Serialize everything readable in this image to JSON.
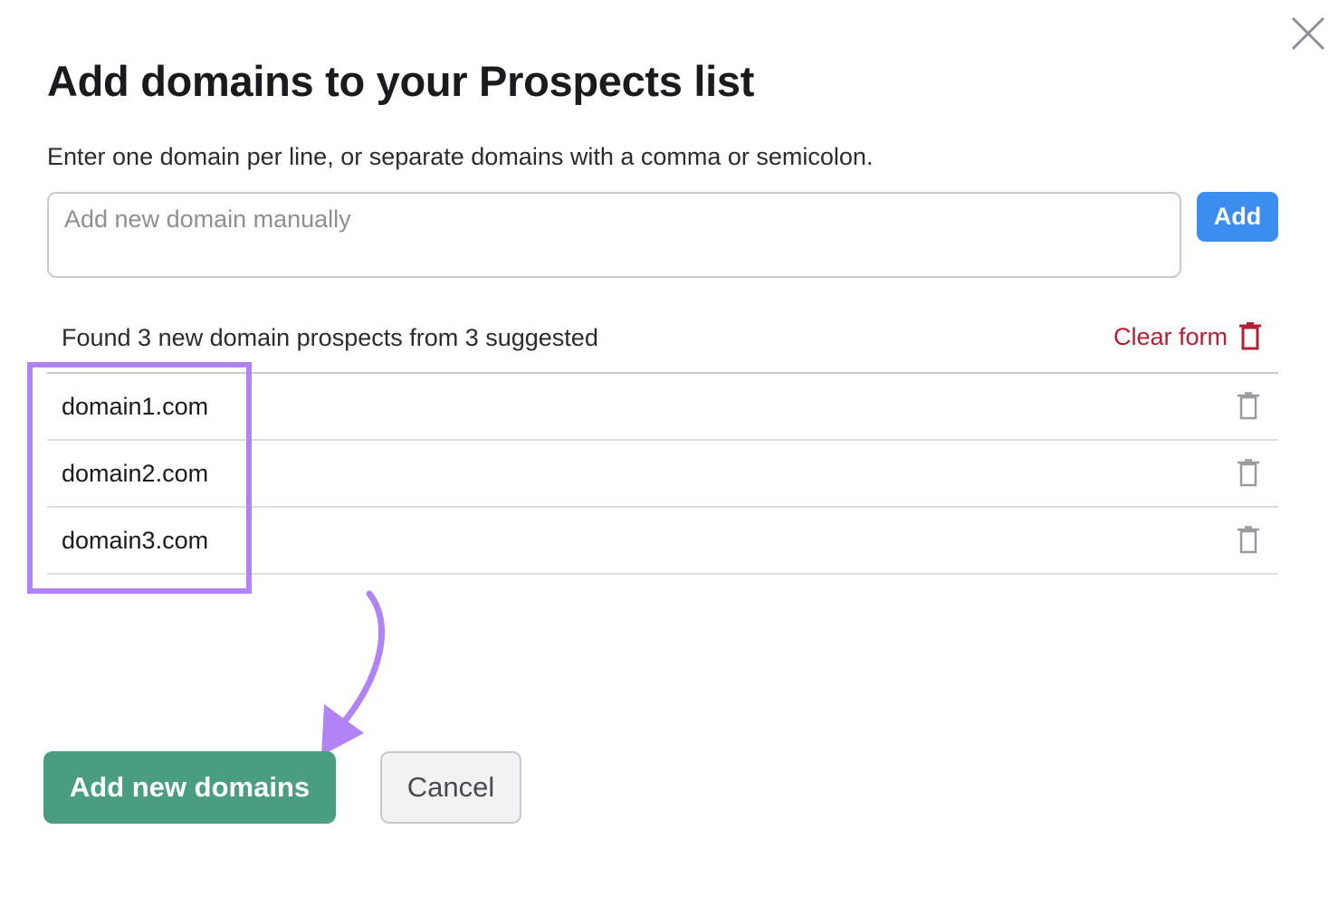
{
  "dialog": {
    "title": "Add domains to your Prospects list",
    "instructions": "Enter one domain per line, or separate domains with a comma or semicolon.",
    "close_icon": "close-icon"
  },
  "input": {
    "placeholder": "Add new domain manually",
    "value": "",
    "add_label": "Add"
  },
  "results": {
    "summary": "Found 3 new domain prospects from 3 suggested",
    "clear_label": "Clear form",
    "clear_icon": "trash-icon",
    "domains": [
      {
        "name": "domain1.com",
        "icon": "trash-icon"
      },
      {
        "name": "domain2.com",
        "icon": "trash-icon"
      },
      {
        "name": "domain3.com",
        "icon": "trash-icon"
      }
    ]
  },
  "actions": {
    "primary_label": "Add new domains",
    "cancel_label": "Cancel"
  },
  "colors": {
    "add_button": "#3b8ef0",
    "primary_button": "#4a9e80",
    "clear_form_text": "#b3202f",
    "annotation": "#b283f4"
  }
}
